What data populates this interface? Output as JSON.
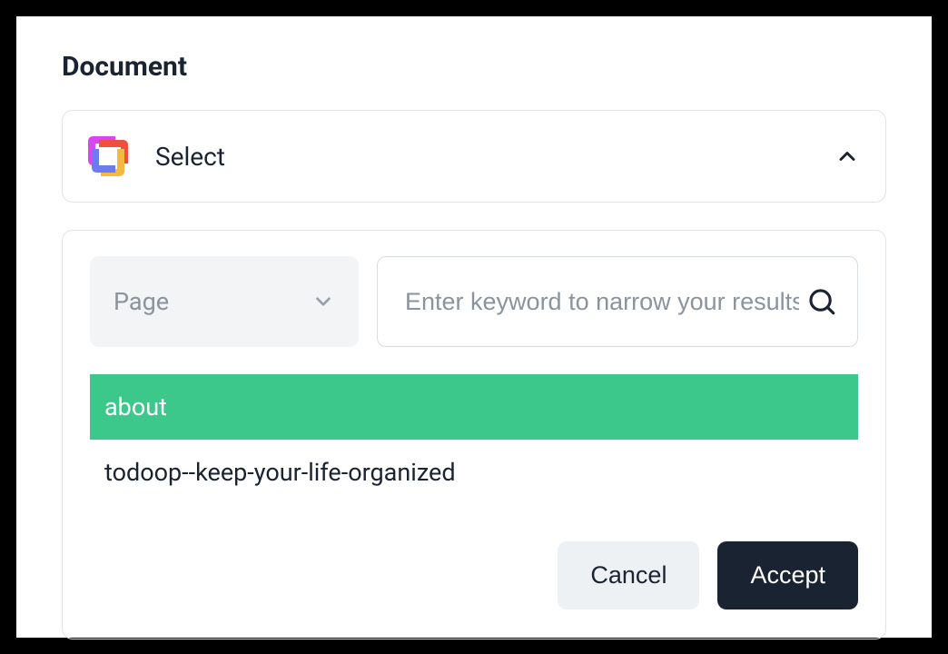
{
  "title": "Document",
  "select": {
    "label": "Select"
  },
  "filter": {
    "page_label": "Page",
    "search_placeholder": "Enter keyword to narrow your results"
  },
  "items": [
    {
      "label": "about"
    },
    {
      "label": "todoop--keep-your-life-organized"
    }
  ],
  "buttons": {
    "cancel": "Cancel",
    "accept": "Accept"
  },
  "colors": {
    "highlight": "#3cc88a",
    "dark": "#1a2332"
  }
}
